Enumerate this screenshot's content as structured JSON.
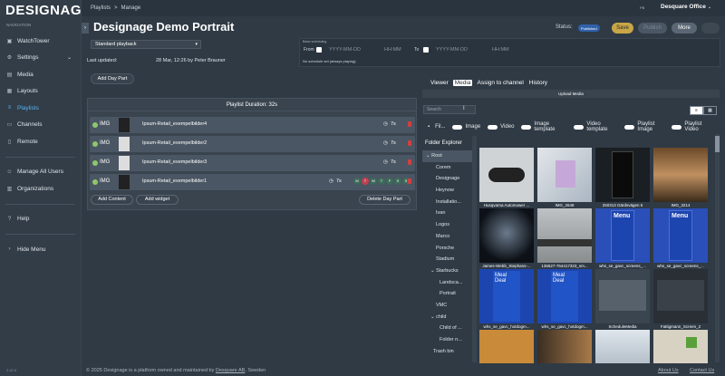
{
  "sidebar": {
    "logo": "DESIGNAGE",
    "nav_label": "NAVIGATION",
    "items": [
      {
        "label": "WatchTower"
      },
      {
        "label": "Settings"
      },
      {
        "label": "Media"
      },
      {
        "label": "Layouts"
      },
      {
        "label": "Playlists"
      },
      {
        "label": "Channels"
      },
      {
        "label": "Remote"
      }
    ],
    "bottom_items": [
      {
        "label": "Manage All Users"
      },
      {
        "label": "Organizations"
      },
      {
        "label": "Help"
      },
      {
        "label": "Hide Menu"
      }
    ],
    "version": "2.42.0"
  },
  "topbar": {
    "crumb1": "Playlists",
    "crumb_sep": ">",
    "crumb2": "Manage",
    "user_initials": "PB",
    "office": "Desquare Office",
    "office_caret": "⌄"
  },
  "header": {
    "title": "Designage Demo Portrait",
    "status_label": "Status:",
    "status_value": "Published",
    "save": "Save",
    "publish": "Publish",
    "more": "More"
  },
  "playback": {
    "selected": "Standard playback",
    "updated_label": "Last updated:",
    "updated_value": "28 Mar, 12:26 by Peter Brauner"
  },
  "schedule": {
    "label": "Basic scheduling",
    "from": "From",
    "to": "To",
    "date_ph": "YYYY-MM-DD",
    "time_ph": "HH:MM",
    "note": "No schedule set (always playing)."
  },
  "dayparts": {
    "add_label": "Add Day Part",
    "duration": "Playlist Duration: 32s",
    "rows": [
      {
        "type": "IMG",
        "name": "Ipsum-Retail_exempelbilder4",
        "duration": "7s",
        "days": []
      },
      {
        "type": "IMG",
        "name": "Ipsum-Retail_exempelbilder2",
        "duration": "7s",
        "days": []
      },
      {
        "type": "IMG",
        "name": "Ipsum-Retail_exempelbilder3",
        "duration": "7s",
        "days": []
      },
      {
        "type": "IMG",
        "name": "Ipsum-Retail_exempelbilder1",
        "duration": "7s",
        "days": [
          "M",
          "T",
          "W",
          "T",
          "F",
          "S",
          "S"
        ]
      }
    ],
    "add_content": "Add Content",
    "add_widget": "Add widget",
    "delete": "Delete Day Part"
  },
  "right": {
    "tabs": [
      "Viewer",
      "Media",
      "Assign to channel",
      "History"
    ],
    "active_tab": "Media",
    "upload": "Upload Media",
    "search_ph": "Search",
    "filters": [
      "Fil...",
      "Image",
      "Video",
      "Image template",
      "Video template",
      "Playlist Image",
      "Playlist Video"
    ],
    "folder_header": "Folder Explorer",
    "folders": [
      "Root",
      "Corem",
      "Designage",
      "Heynow",
      "Installatio...",
      "Ivan",
      "Logos",
      "Marco",
      "Porsche",
      "Stadium",
      "Starbucks",
      "Landsca...",
      "Portrait",
      "VMC",
      "child",
      "Child of ...",
      "Folder n...",
      "Trash bin"
    ],
    "tiles": [
      {
        "caption": "Husqvarna Automower ..."
      },
      {
        "caption": "IMG_2648"
      },
      {
        "caption": "250313 Gärdsvägen 6"
      },
      {
        "caption": "IMG_3214"
      },
      {
        "caption": "James-Webb_Stephans-..."
      },
      {
        "caption": "136527-764417323_sm..."
      },
      {
        "caption": "whs_se_gavc_screens_..."
      },
      {
        "caption": "whs_se_gavc_screens_..."
      },
      {
        "caption": "whs_se_gavc_hotdogm..."
      },
      {
        "caption": "whs_se_gavc_hotdogm..."
      },
      {
        "caption": "ScheduleMedia"
      },
      {
        "caption": "Fattigmann_Screen_2"
      },
      {
        "caption": ""
      },
      {
        "caption": ""
      },
      {
        "caption": ""
      },
      {
        "caption": ""
      }
    ],
    "menu_text": "Menu",
    "meal_text": "Meal Deal"
  },
  "footer": {
    "text": "© 2025 Designage is a platform owned and maintained by",
    "company": "Desquare AB",
    "suffix": ", Sweden",
    "about": "About Us",
    "contact": "Contact Us"
  }
}
